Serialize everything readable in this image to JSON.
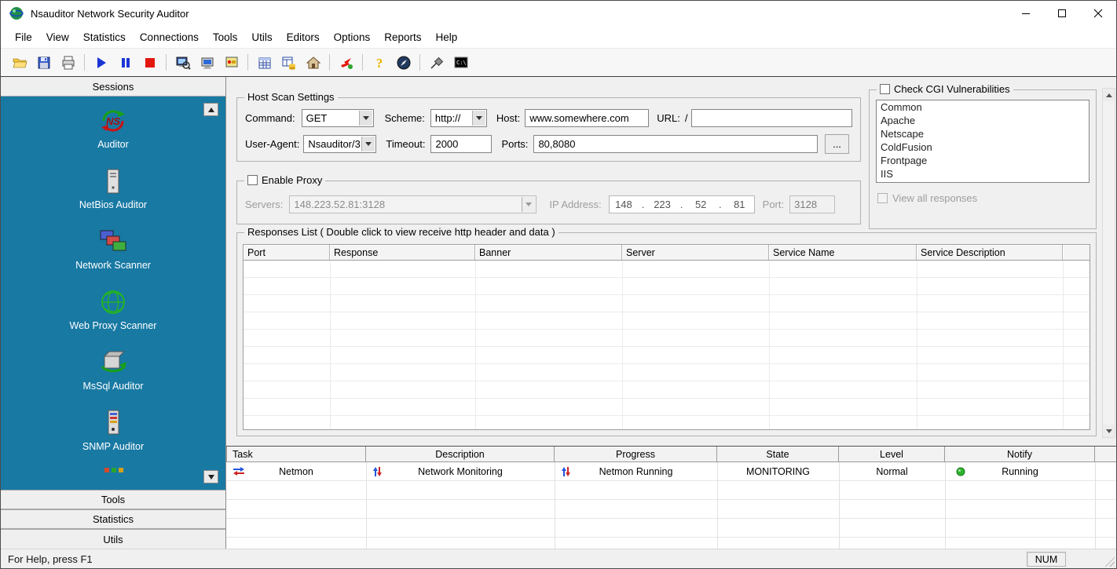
{
  "window": {
    "title": "Nsauditor Network Security Auditor"
  },
  "colors": {
    "sidebar_teal": "#1879a3",
    "start_blue": "#1a35d6",
    "stop_red": "#e3170d",
    "running_green": "#2fb32f"
  },
  "menu": {
    "items": [
      "File",
      "View",
      "Statistics",
      "Connections",
      "Tools",
      "Utils",
      "Editors",
      "Options",
      "Reports",
      "Help"
    ]
  },
  "toolbar": {
    "icons": [
      "open-folder",
      "save",
      "print",
      "start-scan",
      "pause-scan",
      "stop-scan",
      "session-monitor",
      "remote-computer",
      "alerts",
      "packet-filter",
      "rules-editor",
      "home",
      "run-attacks",
      "help",
      "web-browser",
      "pin-window",
      "dos-console"
    ]
  },
  "sidebar": {
    "sessions_label": "Sessions",
    "items": [
      {
        "label": "Auditor"
      },
      {
        "label": "NetBios Auditor"
      },
      {
        "label": "Network Scanner"
      },
      {
        "label": "Web Proxy Scanner"
      },
      {
        "label": "MsSql Auditor"
      },
      {
        "label": "SNMP Auditor"
      }
    ],
    "tools_label": "Tools",
    "statistics_label": "Statistics",
    "utils_label": "Utils"
  },
  "host_scan": {
    "title": "Host Scan Settings",
    "command_label": "Command:",
    "command_value": "GET",
    "scheme_label": "Scheme:",
    "scheme_value": "http://",
    "host_label": "Host:",
    "host_value": "www.somewhere.com",
    "url_label": "URL:",
    "url_prefix": "/",
    "url_value": "",
    "user_agent_label": "User-Agent:",
    "user_agent_value": "Nsauditor/3",
    "timeout_label": "Timeout:",
    "timeout_value": "2000",
    "ports_label": "Ports:",
    "ports_value": "80,8080",
    "browse_label": "..."
  },
  "cgi": {
    "title": "Check CGI Vulnerabilities",
    "items": [
      "Common",
      "Apache",
      "Netscape",
      "ColdFusion",
      "Frontpage",
      "IIS"
    ],
    "view_all_label": "View all responses"
  },
  "proxy": {
    "title": "Enable Proxy",
    "servers_label": "Servers:",
    "servers_value": "148.223.52.81:3128",
    "ip_label": "IP Address:",
    "ip_octet1": "148",
    "ip_octet2": "223",
    "ip_octet3": "52",
    "ip_octet4": "81",
    "dot": ".",
    "port_label": "Port:",
    "port_value": "3128"
  },
  "responses": {
    "title": "Responses List  ( Double click to view receive http header and data )",
    "columns": [
      "Port",
      "Response",
      "Banner",
      "Server",
      "Service Name",
      "Service Description"
    ]
  },
  "tasks": {
    "columns": [
      "Task",
      "Description",
      "Progress",
      "State",
      "Level",
      "Notify"
    ],
    "rows": [
      {
        "task": "Netmon",
        "description": "Network Monitoring",
        "progress": "Netmon Running",
        "state": "MONITORING",
        "level": "Normal",
        "notify": "Running"
      }
    ]
  },
  "statusbar": {
    "help_text": "For Help, press F1",
    "num_label": "NUM"
  }
}
